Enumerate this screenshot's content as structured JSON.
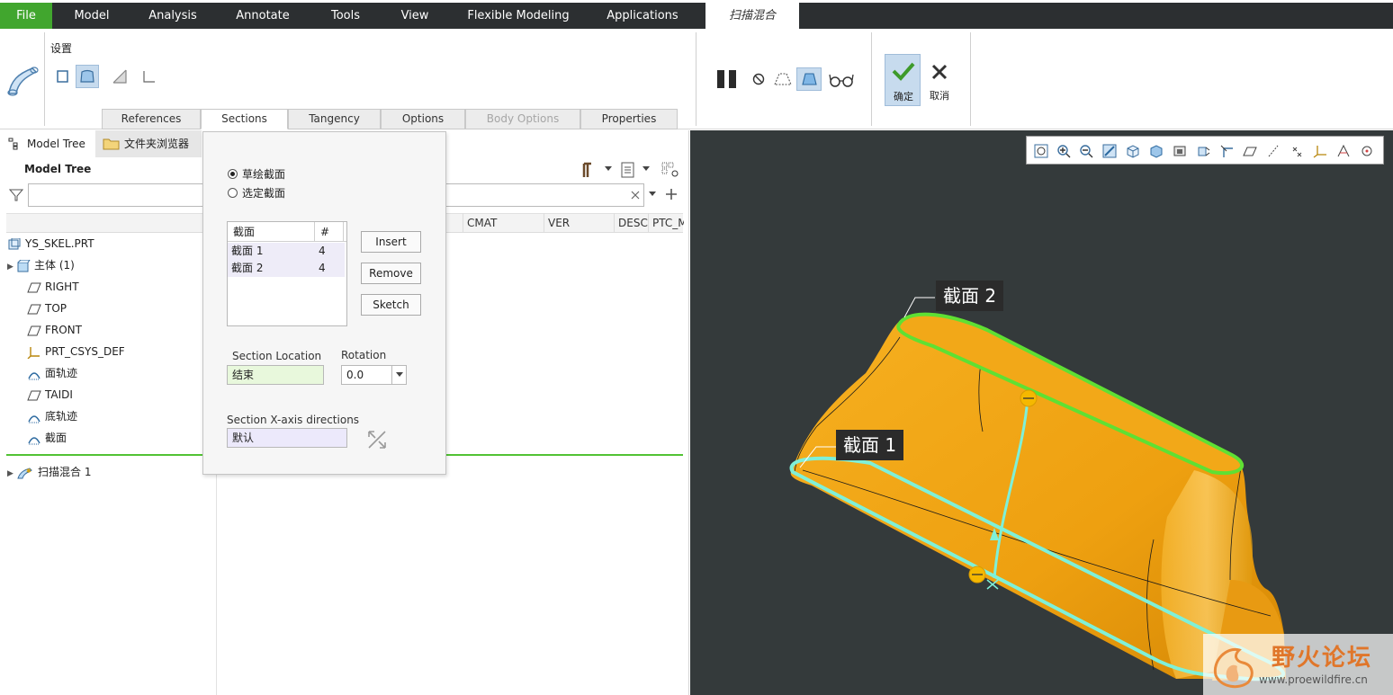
{
  "ribbon_tabs": [
    "File",
    "Model",
    "Analysis",
    "Annotate",
    "Tools",
    "View",
    "Flexible Modeling",
    "Applications",
    "扫描混合"
  ],
  "ribbon": {
    "settings_label": "设置",
    "confirm_label": "确定",
    "cancel_label": "取消"
  },
  "sub_tabs": [
    "References",
    "Sections",
    "Tangency",
    "Options",
    "Body Options",
    "Properties"
  ],
  "left_tabs": {
    "model_tree": "Model Tree",
    "file_browser": "文件夹浏览器"
  },
  "model_tree": {
    "heading": "Model Tree",
    "columns": [
      "CMAT",
      "VER",
      "DESC",
      "PTC_M"
    ],
    "items": [
      {
        "label": "YS_SKEL.PRT",
        "icon": "part-icon"
      },
      {
        "label": "主体 (1)",
        "icon": "body-icon"
      },
      {
        "label": "RIGHT",
        "icon": "datum-plane-icon"
      },
      {
        "label": "TOP",
        "icon": "datum-plane-icon"
      },
      {
        "label": "FRONT",
        "icon": "datum-plane-icon"
      },
      {
        "label": "PRT_CSYS_DEF",
        "icon": "csys-icon"
      },
      {
        "label": "面轨迹",
        "icon": "sketch-icon"
      },
      {
        "label": "TAIDI",
        "icon": "datum-plane-icon"
      },
      {
        "label": "底轨迹",
        "icon": "sketch-icon"
      },
      {
        "label": "截面",
        "icon": "sketch-icon"
      }
    ],
    "feature": "扫描混合 1"
  },
  "sections_panel": {
    "radio_sketched": "草绘截面",
    "radio_selected": "选定截面",
    "table_headers": [
      "截面",
      "#"
    ],
    "rows": [
      {
        "name": "截面 1",
        "count": "4"
      },
      {
        "name": "截面 2",
        "count": "4"
      }
    ],
    "insert": "Insert",
    "remove": "Remove",
    "sketch": "Sketch",
    "location_label": "Section Location",
    "location_value": "结束",
    "rotation_label": "Rotation",
    "rotation_value": "0.0",
    "xaxis_label": "Section X-axis directions",
    "xaxis_value": "默认"
  },
  "viewport": {
    "section1_label": "截面 1",
    "section2_label": "截面 2",
    "watermark_title": "野火论坛",
    "watermark_url": "www.proewildfire.cn",
    "colors": {
      "background": "#343a3b",
      "part": "#f0a416",
      "section2": "#5fe033",
      "section1": "#7ff0d8"
    }
  }
}
